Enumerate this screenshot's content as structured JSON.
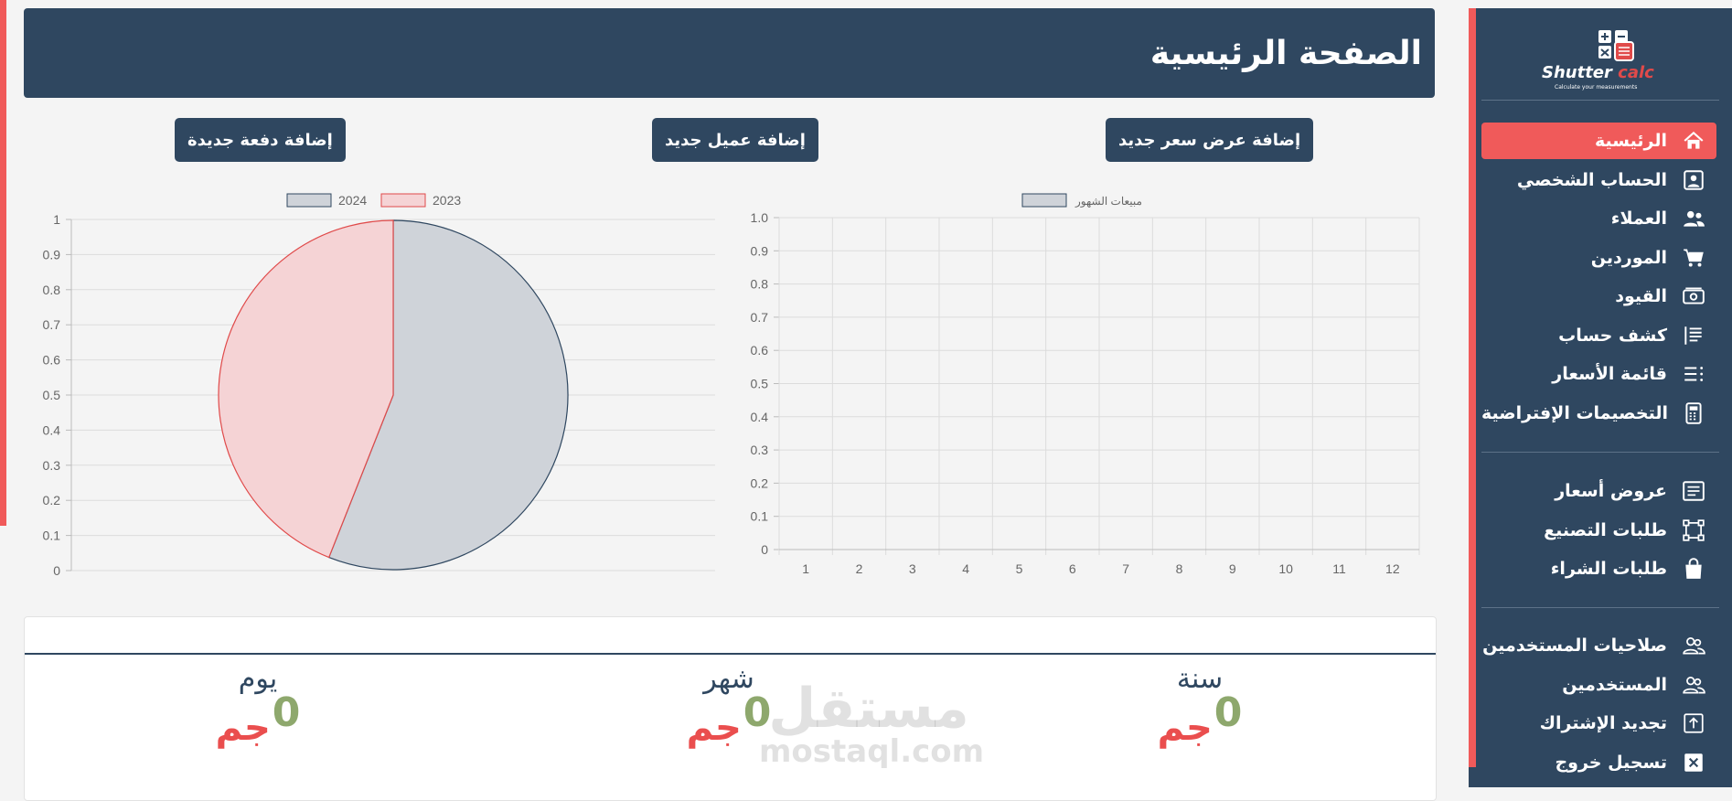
{
  "app": {
    "brand_name": "Shutter calc",
    "brand_tagline": "Calculate your measurements"
  },
  "header": {
    "title": "الصفحة الرئيسية"
  },
  "actions": {
    "add_quote": "إضافة عرض سعر جديد",
    "add_client": "إضافة عميل جديد",
    "add_payment": "إضافة دفعة جديدة"
  },
  "sidebar": {
    "items": [
      {
        "label": "الرئيسية",
        "icon": "home-icon",
        "active": true
      },
      {
        "label": "الحساب الشخصي",
        "icon": "profile-icon"
      },
      {
        "label": "العملاء",
        "icon": "users-icon"
      },
      {
        "label": "الموردين",
        "icon": "cart-icon"
      },
      {
        "label": "القيود",
        "icon": "money-icon"
      },
      {
        "label": "كشف حساب",
        "icon": "statement-icon"
      },
      {
        "label": "قائمة الأسعار",
        "icon": "list-icon"
      },
      {
        "label": "التخصيمات الإفتراضية",
        "icon": "calculator-icon"
      }
    ],
    "items2": [
      {
        "label": "عروض أسعار",
        "icon": "quote-icon"
      },
      {
        "label": "طلبات التصنيع",
        "icon": "manufacture-icon"
      },
      {
        "label": "طلبات الشراء",
        "icon": "bag-icon"
      }
    ],
    "items3": [
      {
        "label": "صلاحيات المستخدمين",
        "icon": "permissions-icon"
      },
      {
        "label": "المستخدمين",
        "icon": "users-outline-icon"
      },
      {
        "label": "تجديد الإشتراك",
        "icon": "upload-icon"
      },
      {
        "label": "تسجيل خروج",
        "icon": "close-icon"
      }
    ],
    "colors": {
      "bg": "#2f4760",
      "accent": "#f05a5a"
    }
  },
  "chart_data": [
    {
      "type": "line",
      "legend": [
        "مبيعات الشهور"
      ],
      "legend_position": "top",
      "x": [
        1,
        2,
        3,
        4,
        5,
        6,
        7,
        8,
        9,
        10,
        11,
        12
      ],
      "series": [
        {
          "name": "مبيعات الشهور",
          "values": []
        }
      ],
      "y_ticks": [
        "0",
        "0.1",
        "0.2",
        "0.3",
        "0.4",
        "0.5",
        "0.6",
        "0.7",
        "0.8",
        "0.9",
        "1.0"
      ],
      "ylim": [
        0,
        1
      ],
      "grid": true
    },
    {
      "type": "pie",
      "legend": [
        "2023",
        "2024"
      ],
      "legend_position": "top",
      "slices": [
        {
          "label": "2024",
          "value": 0.56,
          "color": "#cfd3d9",
          "border": "#2f4760"
        },
        {
          "label": "2023",
          "value": 0.44,
          "color": "#f5d3d5",
          "border": "#e04a4a"
        }
      ],
      "y_ticks": [
        "0",
        "0.1",
        "0.2",
        "0.3",
        "0.4",
        "0.5",
        "0.6",
        "0.7",
        "0.8",
        "0.9",
        "1"
      ],
      "ylim": [
        0,
        1
      ],
      "grid": true
    }
  ],
  "stats": [
    {
      "label": "سنة",
      "value": "0",
      "currency": "جم"
    },
    {
      "label": "شهر",
      "value": "0",
      "currency": "جم"
    },
    {
      "label": "يوم",
      "value": "0",
      "currency": "جم"
    }
  ],
  "watermark": {
    "ar": "مستقل",
    "en": "mostaql.com"
  }
}
